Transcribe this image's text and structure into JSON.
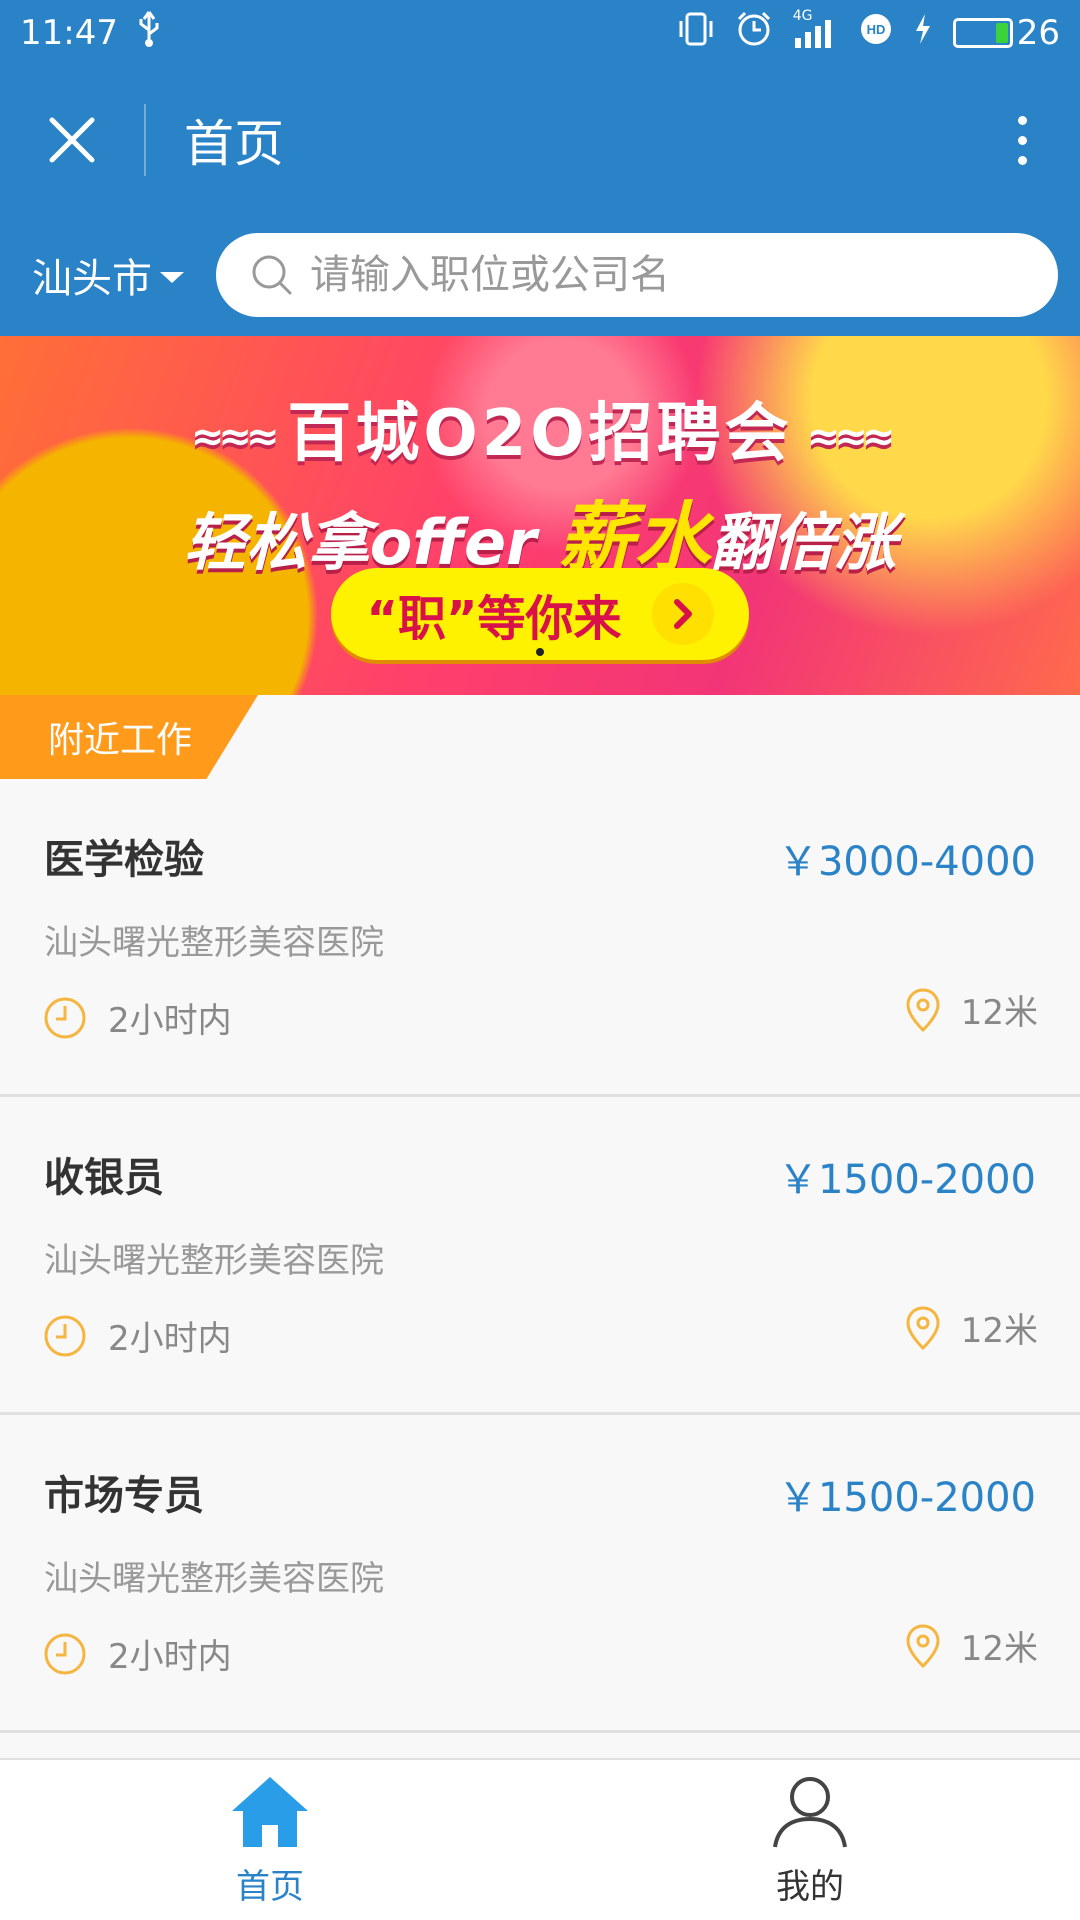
{
  "status_bar": {
    "time": "11:47",
    "network": "4G",
    "battery": "26"
  },
  "header": {
    "title": "首页"
  },
  "search": {
    "city": "汕头市",
    "placeholder": "请输入职位或公司名"
  },
  "banner": {
    "line1": "百城O2O招聘会",
    "line2_prefix": "轻松拿offer ",
    "line2_highlight": "薪水",
    "line2_suffix": "翻倍涨",
    "cta": "“职”等你来"
  },
  "section": {
    "label": "附近工作"
  },
  "jobs": [
    {
      "title": "医学检验",
      "salary": "￥3000-4000",
      "company": "汕头曙光整形美容医院",
      "time": "2小时内",
      "distance": "12米"
    },
    {
      "title": "收银员",
      "salary": "￥1500-2000",
      "company": "汕头曙光整形美容医院",
      "time": "2小时内",
      "distance": "12米"
    },
    {
      "title": "市场专员",
      "salary": "￥1500-2000",
      "company": "汕头曙光整形美容医院",
      "time": "2小时内",
      "distance": "12米"
    }
  ],
  "nav": {
    "home_label": "首页",
    "mine_label": "我的"
  },
  "colors": {
    "primary": "#2a82c7",
    "accent_orange": "#ff9a1a",
    "icon_orange": "#f5b53f"
  },
  "icons": [
    "usb-icon",
    "vibrate-icon",
    "alarm-icon",
    "signal-icon",
    "hd-icon",
    "charging-icon",
    "battery-icon",
    "close-icon",
    "more-icon",
    "search-icon",
    "clock-icon",
    "location-pin-icon",
    "home-icon",
    "user-icon"
  ]
}
